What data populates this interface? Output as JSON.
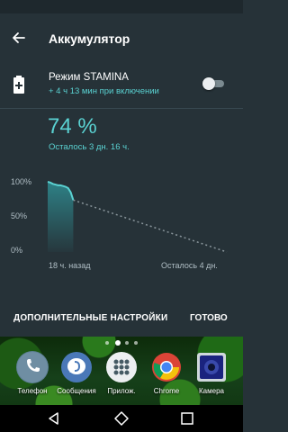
{
  "header": {
    "title": "Аккумулятор"
  },
  "stamina": {
    "title": "Режим STAMINA",
    "subtitle": "+ 4 ч 13 мин при включении",
    "enabled": false
  },
  "battery": {
    "percent_text": "74 %",
    "remaining_text": "Осталось 3 дн. 16 ч."
  },
  "chart_data": {
    "type": "area",
    "y_ticks": [
      "100%",
      "50%",
      "0%"
    ],
    "x_start_label": "18 ч. назад",
    "x_end_label": "Осталось 4 дн.",
    "ylim": [
      0,
      100
    ],
    "history": {
      "name": "",
      "x": [
        0,
        0.1,
        0.2,
        0.3,
        0.4,
        0.5,
        0.6,
        0.7,
        0.8,
        0.9,
        1.0
      ],
      "values": [
        100,
        99,
        97,
        96,
        95,
        95,
        94,
        93,
        91,
        85,
        74
      ]
    },
    "projection": {
      "name": "",
      "x": [
        1.0,
        7.0
      ],
      "values": [
        74,
        0
      ]
    },
    "x_total": 7.0
  },
  "actions": {
    "more_settings": "ДОПОЛНИТЕЛЬНЫЕ НАСТРОЙКИ",
    "done": "ГОТОВО"
  },
  "dock": [
    {
      "label": "Телефон",
      "icon": "phone-icon"
    },
    {
      "label": "Сообщения",
      "icon": "messages-icon"
    },
    {
      "label": "Прилож.",
      "icon": "apps-icon"
    },
    {
      "label": "Chrome",
      "icon": "chrome-icon"
    },
    {
      "label": "Камера",
      "icon": "camera-icon"
    }
  ],
  "colors": {
    "accent": "#5ad2d2",
    "background": "#263238"
  }
}
